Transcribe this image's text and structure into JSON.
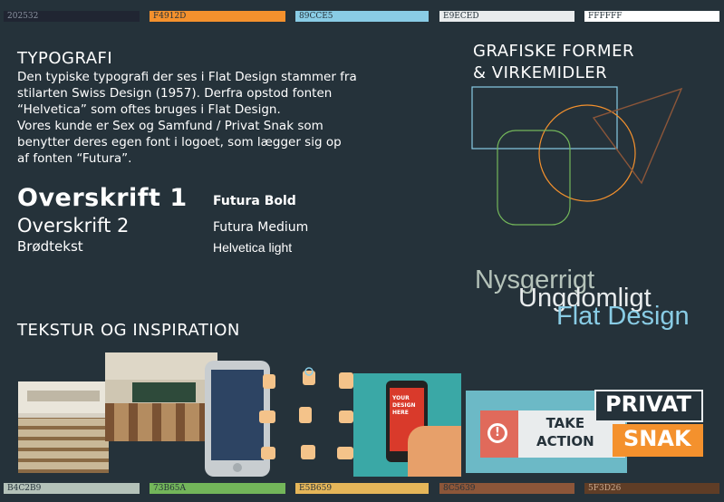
{
  "swatches_top": [
    {
      "hex": "202532",
      "color": "#202532",
      "text_color": "#8a93a0"
    },
    {
      "hex": "F4912D",
      "color": "#F4912D",
      "text_color": "#25323a"
    },
    {
      "hex": "89CCE5",
      "color": "#89CCE5",
      "text_color": "#25323a"
    },
    {
      "hex": "E9ECED",
      "color": "#E9ECED",
      "text_color": "#25323a"
    },
    {
      "hex": "FFFFFF",
      "color": "#FFFFFF",
      "text_color": "#25323a"
    }
  ],
  "swatches_bottom": [
    {
      "hex": "B4C2B9",
      "color": "#B4C2B9",
      "text_color": "#25323a"
    },
    {
      "hex": "73B65A",
      "color": "#73B65A",
      "text_color": "#25323a"
    },
    {
      "hex": "E5B659",
      "color": "#E5B659",
      "text_color": "#25323a"
    },
    {
      "hex": "8C5639",
      "color": "#8C5639",
      "text_color": "#25323a"
    },
    {
      "hex": "5F3D26",
      "color": "#5F3D26",
      "text_color": "#c9a98e"
    }
  ],
  "typography": {
    "heading": "TYPOGRAFI",
    "paragraph_lines": [
      "Den typiske typografi der ses i Flat Design stammer fra",
      "stilarten Swiss Design (1957). Derfra opstod fonten",
      "“Helvetica” som oftes bruges i Flat Design.",
      "Vores kunde er Sex og Samfund / Privat Snak som",
      "benytter deres egen font i logoet, som lægger sig op",
      "af fonten “Futura”."
    ],
    "samples": [
      {
        "label": "Overskrift 1",
        "font": "Futura Bold"
      },
      {
        "label": "Overskrift 2",
        "font": "Futura Medium"
      },
      {
        "label": "Brødtekst",
        "font": "Helvetica light"
      }
    ]
  },
  "shapes": {
    "heading_line1": "GRAFISKE FORMER",
    "heading_line2": "& VIRKEMIDLER"
  },
  "mood_words": [
    "Nysgerrigt",
    "Ungdomligt",
    "Flat Design"
  ],
  "inspiration": {
    "heading": "TEKSTUR OG INSPIRATION",
    "phone_screen_text": [
      "YOUR",
      "DESIGN",
      "HERE"
    ],
    "action_text": [
      "TAKE",
      "ACTION"
    ],
    "logo_lines": [
      "PRIVAT",
      "SNAK"
    ]
  }
}
